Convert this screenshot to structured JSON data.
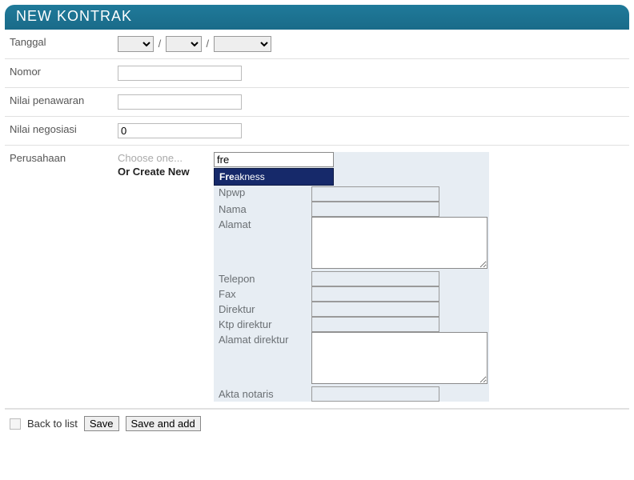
{
  "header": {
    "title": "NEW KONTRAK"
  },
  "labels": {
    "tanggal": "Tanggal",
    "nomor": "Nomor",
    "nilai_penawaran": "Nilai penawaran",
    "nilai_negosiasi": "Nilai negosiasi",
    "perusahaan": "Perusahaan"
  },
  "values": {
    "nomor": "",
    "nilai_penawaran": "",
    "nilai_negosiasi": "0",
    "choose_filter": "fre"
  },
  "perusahaan": {
    "choose_one": "Choose one...",
    "or_create_new": "Or Create New",
    "autocomplete_match_bold": "Fre",
    "autocomplete_match_rest": "akness",
    "sub_labels": {
      "npwp": "Npwp",
      "nama": "Nama",
      "alamat": "Alamat",
      "telepon": "Telepon",
      "fax": "Fax",
      "direktur": "Direktur",
      "ktp_direktur": "Ktp direktur",
      "alamat_direktur": "Alamat direktur",
      "akta_notaris": "Akta notaris"
    }
  },
  "footer": {
    "back_to_list": "Back to list",
    "save": "Save",
    "save_and_add": "Save and add"
  }
}
